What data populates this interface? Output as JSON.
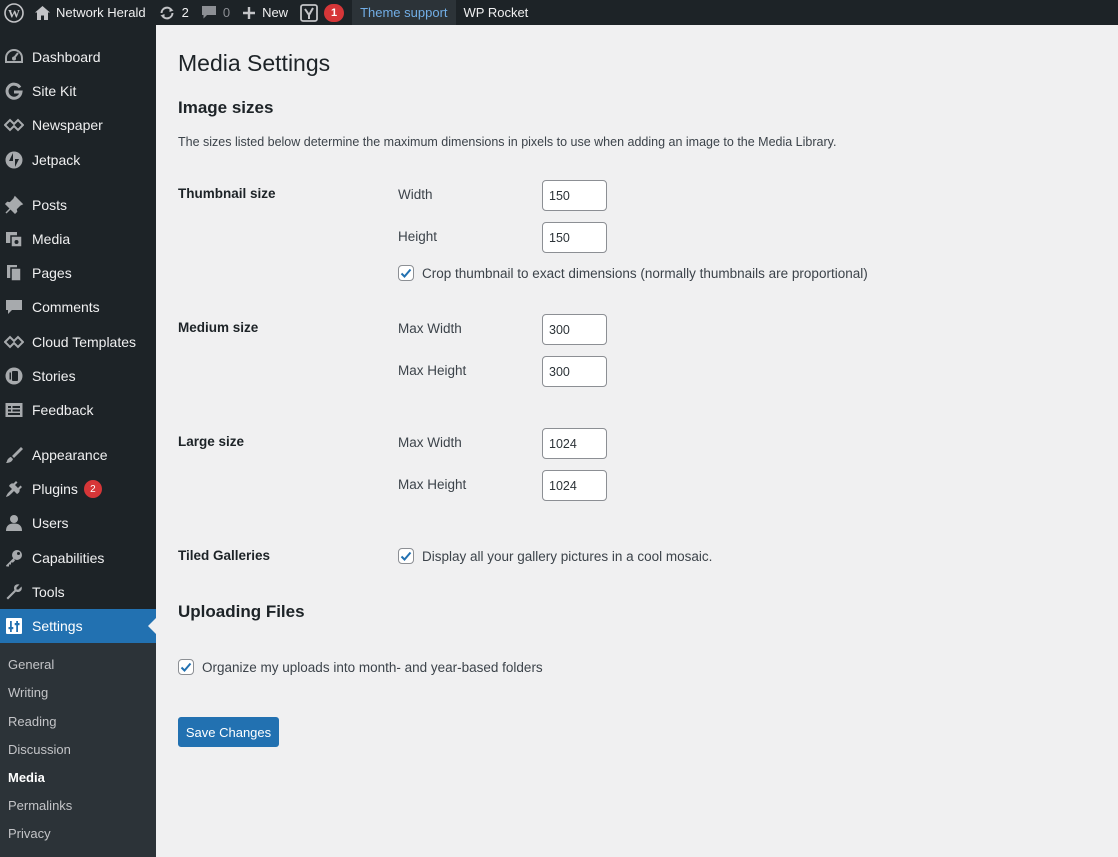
{
  "admin_bar": {
    "site_name": "Network Herald",
    "updates_count": "2",
    "comments_count": "0",
    "new_label": "New",
    "yoast_count": "1",
    "theme_support": "Theme support",
    "wp_rocket": "WP Rocket"
  },
  "sidebar": {
    "items": [
      {
        "label": "Dashboard",
        "icon": "dashboard-icon"
      },
      {
        "label": "Site Kit",
        "icon": "google-g-icon"
      },
      {
        "label": "Newspaper",
        "icon": "diamond-icon"
      },
      {
        "label": "Jetpack",
        "icon": "jetpack-icon"
      },
      {
        "label": "Posts",
        "icon": "pin-icon"
      },
      {
        "label": "Media",
        "icon": "media-icon"
      },
      {
        "label": "Pages",
        "icon": "pages-icon"
      },
      {
        "label": "Comments",
        "icon": "comment-icon"
      },
      {
        "label": "Cloud Templates",
        "icon": "diamond-icon"
      },
      {
        "label": "Stories",
        "icon": "stories-icon"
      },
      {
        "label": "Feedback",
        "icon": "feedback-icon"
      },
      {
        "label": "Appearance",
        "icon": "brush-icon"
      },
      {
        "label": "Plugins",
        "icon": "plug-icon",
        "badge": "2"
      },
      {
        "label": "Users",
        "icon": "user-icon"
      },
      {
        "label": "Capabilities",
        "icon": "key-icon"
      },
      {
        "label": "Tools",
        "icon": "wrench-icon"
      },
      {
        "label": "Settings",
        "icon": "settings-icon"
      }
    ],
    "submenu": [
      "General",
      "Writing",
      "Reading",
      "Discussion",
      "Media",
      "Permalinks",
      "Privacy"
    ],
    "current_submenu": "Media"
  },
  "page": {
    "title": "Media Settings",
    "image_sizes": {
      "heading": "Image sizes",
      "description": "The sizes listed below determine the maximum dimensions in pixels to use when adding an image to the Media Library.",
      "thumbnail": {
        "label": "Thumbnail size",
        "width_label": "Width",
        "width_value": "150",
        "height_label": "Height",
        "height_value": "150",
        "crop_label": "Crop thumbnail to exact dimensions (normally thumbnails are proportional)",
        "crop_checked": true
      },
      "medium": {
        "label": "Medium size",
        "max_width_label": "Max Width",
        "max_width_value": "300",
        "max_height_label": "Max Height",
        "max_height_value": "300"
      },
      "large": {
        "label": "Large size",
        "max_width_label": "Max Width",
        "max_width_value": "1024",
        "max_height_label": "Max Height",
        "max_height_value": "1024"
      },
      "tiled": {
        "label": "Tiled Galleries",
        "checkbox_label": "Display all your gallery pictures in a cool mosaic.",
        "checked": true
      }
    },
    "uploading": {
      "heading": "Uploading Files",
      "organize_label": "Organize my uploads into month- and year-based folders",
      "organize_checked": true
    },
    "save_label": "Save Changes"
  },
  "colors": {
    "admin_bar_bg": "#1d2327",
    "sidebar_bg": "#1d2327",
    "submenu_bg": "#2c3338",
    "accent": "#2271b1",
    "link": "#72aee6",
    "badge": "#d63638",
    "content_bg": "#f0f0f1"
  }
}
